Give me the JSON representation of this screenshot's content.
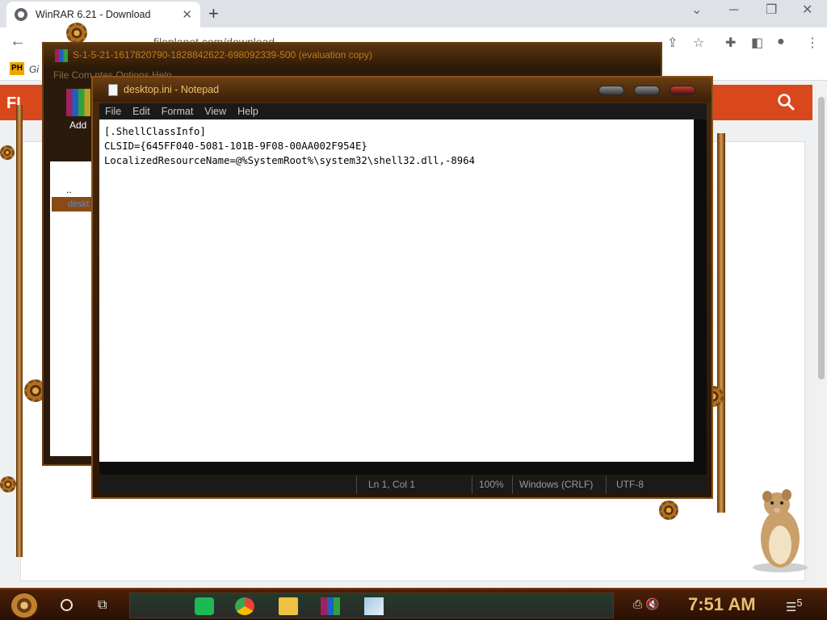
{
  "browser": {
    "tab_title": "WinRAR  6.21 - Download",
    "tab_close": "✕",
    "new_tab": "+",
    "back": "←",
    "url": "filеplanet.com/download",
    "bookmark_badge": "PH",
    "bookmark_label": "Gi"
  },
  "site": {
    "logo": "FI"
  },
  "winrar": {
    "title": "S-1-5-21-1617820790-1828842622-698092339-500 (evaluation copy)",
    "menu": "File   Com          ntes   Options   Help",
    "add_label": "Add",
    "list_up": "..",
    "list_item": "deskt"
  },
  "notepad": {
    "title": "desktop.ini - Notepad",
    "menu": {
      "file": "File",
      "edit": "Edit",
      "format": "Format",
      "view": "View",
      "help": "Help"
    },
    "content": "[.ShellClassInfo]\nCLSID={645FF040-5081-101B-9F08-00AA002F954E}\nLocalizedResourceName=@%SystemRoot%\\system32\\shell32.dll,-8964",
    "status": {
      "position": "Ln 1, Col 1",
      "zoom": "100%",
      "line_ending": "Windows (CRLF)",
      "encoding": "UTF-8"
    }
  },
  "taskbar": {
    "clock": "7:51 AM",
    "notif_count": "5"
  },
  "colors": {
    "site_accent": "#d9481d",
    "theme_brass": "#c47a1a"
  }
}
